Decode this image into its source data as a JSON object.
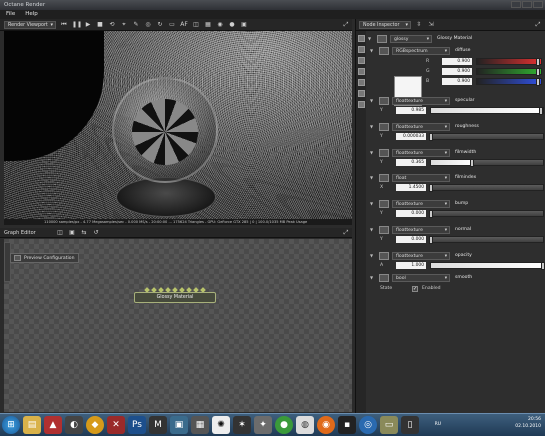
{
  "window": {
    "title": "Octane Render"
  },
  "menu": [
    "File",
    "Help"
  ],
  "viewport": {
    "mode": "Render Viewport",
    "status": "110000 samples/px - 4.77 Megasamples/sec - 0.000 MS/s - 20:00:00 ... 175624 Triangles - GPU: GeForce GTX 285 | 0 | 100.0/1035 MB Peak Usage"
  },
  "graph_editor": {
    "title": "Graph Editor",
    "side_tab": "Graph Editor",
    "preview_node": "Preview Configuration",
    "material_node": "Glossy Material"
  },
  "inspector": {
    "title": "Node Inspector",
    "material_type": "glossy",
    "material_name": "Glossy Material",
    "diffuse": {
      "type": "RGBspectrum",
      "name": "diffuse",
      "r": "0.900",
      "g": "0.900",
      "b": "0.900"
    },
    "params": [
      {
        "type": "floattexture",
        "name": "specular",
        "label": "Y",
        "value": "0.985",
        "level": 0.985
      },
      {
        "type": "floattexture",
        "name": "roughness",
        "label": "Y",
        "value": "0.000033",
        "level": 0.0
      },
      {
        "type": "floattexture",
        "name": "filmwidth",
        "label": "Y",
        "value": "0.365",
        "level": 0.365
      },
      {
        "type": "float",
        "name": "filmindex",
        "label": "X",
        "value": "1.4500",
        "level": 0.0
      },
      {
        "type": "floattexture",
        "name": "bump",
        "label": "Y",
        "value": "0.000",
        "level": 0.0
      },
      {
        "type": "floattexture",
        "name": "normal",
        "label": "Y",
        "value": "0.000",
        "level": 0.0
      },
      {
        "type": "floattexture",
        "name": "opacity",
        "label": "A",
        "value": "1.000",
        "level": 1.0
      }
    ],
    "smooth": {
      "type": "bool",
      "name": "smooth",
      "label": "State",
      "value": "Enabled",
      "checked": true
    }
  },
  "taskbar": {
    "lang": "RU",
    "time": "20:56",
    "date": "02.10.2010"
  },
  "colors": {
    "accent": "#b8c36b",
    "graph_bg": "#4a4a4a"
  }
}
